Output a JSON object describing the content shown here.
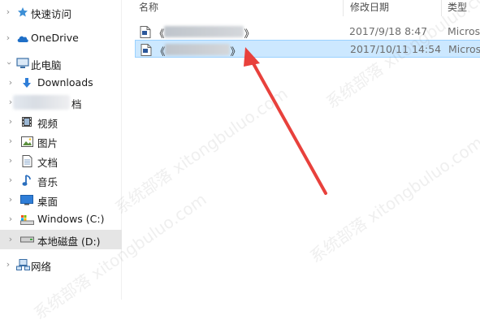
{
  "sidebar": {
    "quick_access": "快速访问",
    "onedrive": "OneDrive",
    "this_pc": "此电脑",
    "downloads": "Downloads",
    "documents_blurred_suffix": "档",
    "videos": "视频",
    "pictures": "图片",
    "documents": "文档",
    "music": "音乐",
    "desktop": "桌面",
    "drive_c": "Windows (C:)",
    "drive_d": "本地磁盘 (D:)",
    "network": "网络"
  },
  "columns": {
    "name": "名称",
    "date_modified": "修改日期",
    "type": "类型"
  },
  "files": [
    {
      "name_prefix": "《",
      "name_suffix": "》",
      "date": "2017/9/18 8:47",
      "type": "Micros"
    },
    {
      "name_prefix": "《",
      "name_suffix": "》",
      "date": "2017/10/11 14:54",
      "type": "Micros"
    }
  ],
  "watermark": "系统部落 xitongbuluo.com",
  "colors": {
    "selection": "#cce8ff",
    "selection_border": "#99d1ff",
    "arrow": "#e8413c",
    "sidebar_selected": "#e5e5e5"
  }
}
